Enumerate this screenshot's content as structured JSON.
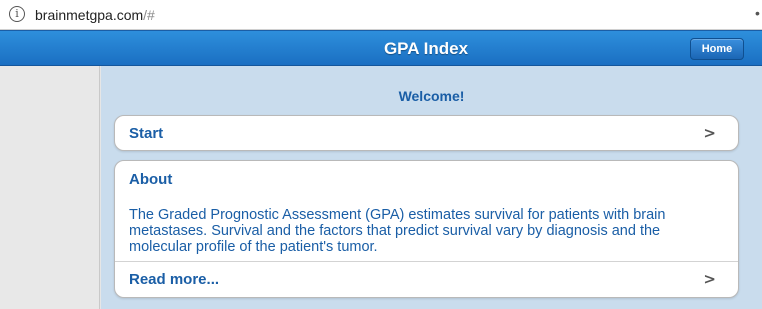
{
  "browser": {
    "url_host": "brainmetgpa.com",
    "url_path": "/#",
    "menu_dot": "•"
  },
  "header": {
    "title": "GPA Index",
    "home_label": "Home"
  },
  "main": {
    "welcome": "Welcome!",
    "start_label": "Start",
    "about": {
      "title": "About",
      "text": "The Graded Prognostic Assessment (GPA) estimates survival for patients with brain metastases. Survival and the factors that predict survival vary by diagnosis and the molecular profile of the patient's tumor.",
      "read_more": "Read more..."
    },
    "chevron": ">"
  },
  "icons": {
    "info": "info-icon",
    "chevron": "chevron-right-icon"
  },
  "colors": {
    "header": "#1a6fc2",
    "text_blue": "#1a5ea6",
    "content_bg": "#c9dced"
  }
}
